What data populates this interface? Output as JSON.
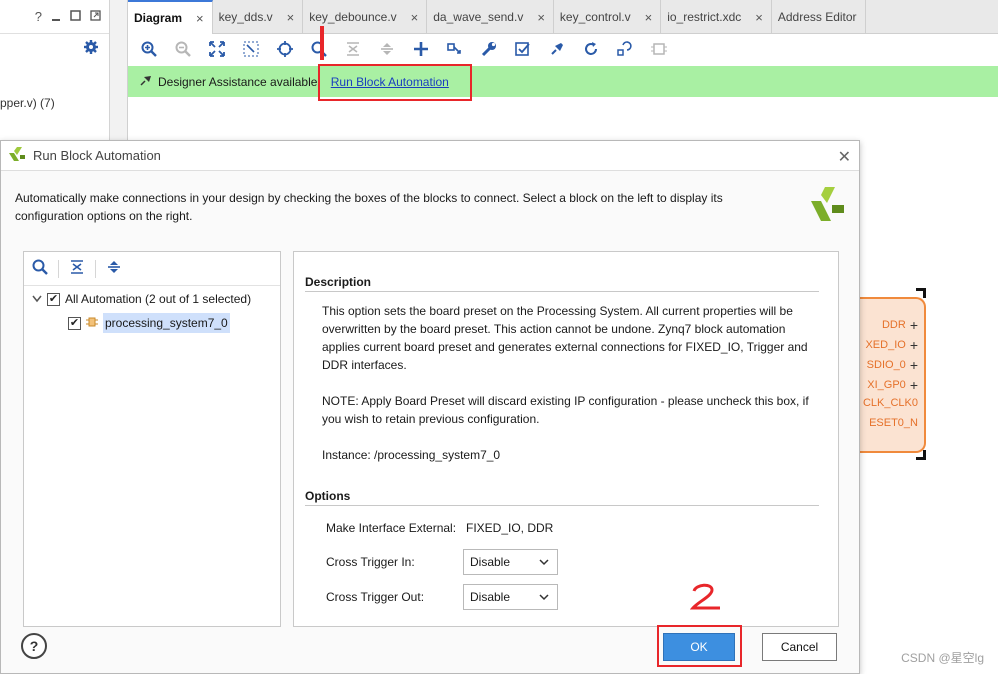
{
  "left_panel": {
    "icons": [
      "help-icon",
      "minimize-icon",
      "maximize-icon",
      "float-icon"
    ],
    "help_glyph": "?",
    "item_label": "pper.v) (7)"
  },
  "tabs": [
    {
      "label": "Diagram",
      "active": true
    },
    {
      "label": "key_dds.v"
    },
    {
      "label": "key_debounce.v"
    },
    {
      "label": "da_wave_send.v"
    },
    {
      "label": "key_control.v"
    },
    {
      "label": "io_restrict.xdc"
    },
    {
      "label": "Address Editor"
    }
  ],
  "tab_close_glyph": "×",
  "assist_bar": {
    "message": "Designer Assistance available.",
    "link": "Run Block Automation",
    "bg_color": "#a9f0a3"
  },
  "ip_block": {
    "ports": [
      "DDR",
      "XED_IO",
      "SDIO_0",
      "XI_GP0",
      "CLK_CLK0",
      "ESET0_N"
    ]
  },
  "watermark": "CSDN @星空lg",
  "dialog": {
    "title": "Run Block Automation",
    "close_glyph": "✕",
    "intro": "Automatically make connections in your design by checking the boxes of the blocks to connect. Select a block on the left to display its configuration options on the right.",
    "tree": {
      "root_label": "All Automation (2 out of 1 selected)",
      "child_label": "processing_system7_0",
      "checkmark": "✔"
    },
    "description": {
      "heading": "Description",
      "para1": "This option sets the board preset on the Processing System. All current properties will be overwritten by the board preset. This action cannot be undone. Zynq7 block automation applies current board preset and generates external connections for FIXED_IO, Trigger and DDR interfaces.",
      "para2": "NOTE: Apply Board Preset will discard existing IP configuration - please uncheck this box, if you wish to retain previous configuration.",
      "para3": "Instance: /processing_system7_0"
    },
    "options": {
      "heading": "Options",
      "make_external_label": "Make Interface External:",
      "make_external_value": "FIXED_IO, DDR",
      "cross_trigger_in_label": "Cross Trigger In:",
      "cross_trigger_in_value": "Disable",
      "cross_trigger_out_label": "Cross Trigger Out:",
      "cross_trigger_out_value": "Disable"
    },
    "help_label": "?",
    "ok_label": "OK",
    "cancel_label": "Cancel"
  },
  "accent_color": "#3d8fe0",
  "annotation_color": "#e8262a"
}
